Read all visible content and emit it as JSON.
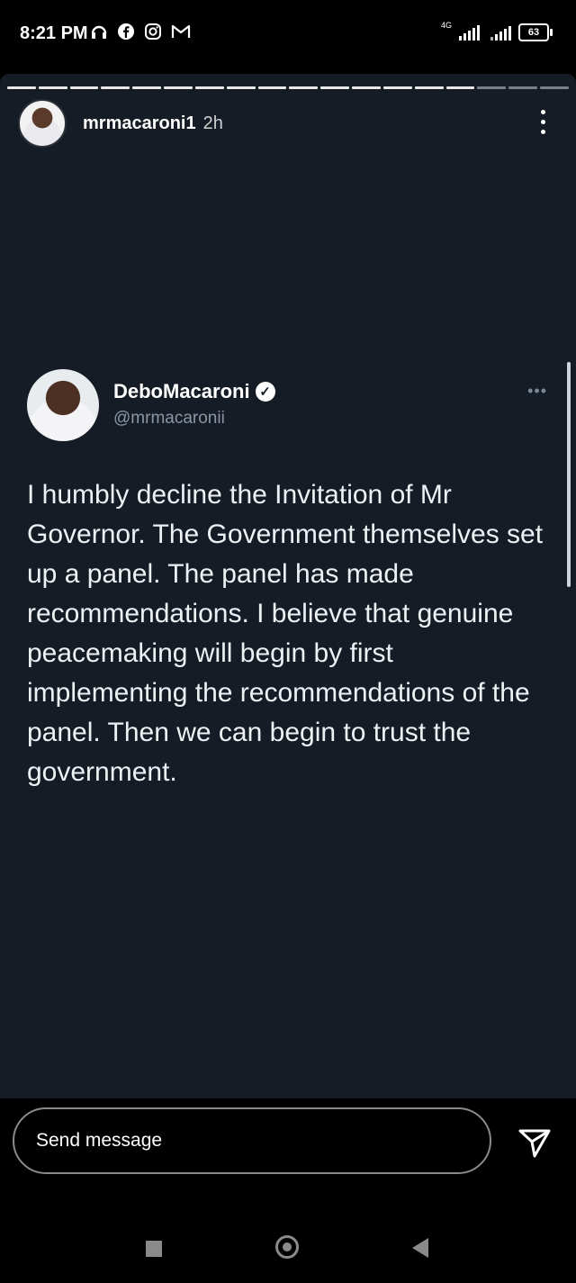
{
  "status_bar": {
    "time": "8:21 PM",
    "left_icons": [
      "headphones-icon",
      "facebook-icon",
      "instagram-icon",
      "gmail-icon"
    ],
    "network": "4G",
    "battery": "63"
  },
  "story": {
    "progress_segments_total": 18,
    "progress_segments_viewed": 15,
    "username": "mrmacaroni1",
    "time_ago": "2h"
  },
  "tweet": {
    "display_name": "DeboMacaroni",
    "verified_mark": "✓",
    "handle": "@mrmacaronii",
    "more_label": "•••",
    "text": "I humbly decline the Invitation of Mr Governor. The Government themselves set up a panel. The panel has made recommendations. I believe that genuine peacemaking will begin by first implementing the recommendations of the panel. Then we can begin to trust the government."
  },
  "reply": {
    "placeholder": "Send message"
  },
  "colors": {
    "story_background": "#161c26",
    "handle_gray": "#8b96a3"
  }
}
